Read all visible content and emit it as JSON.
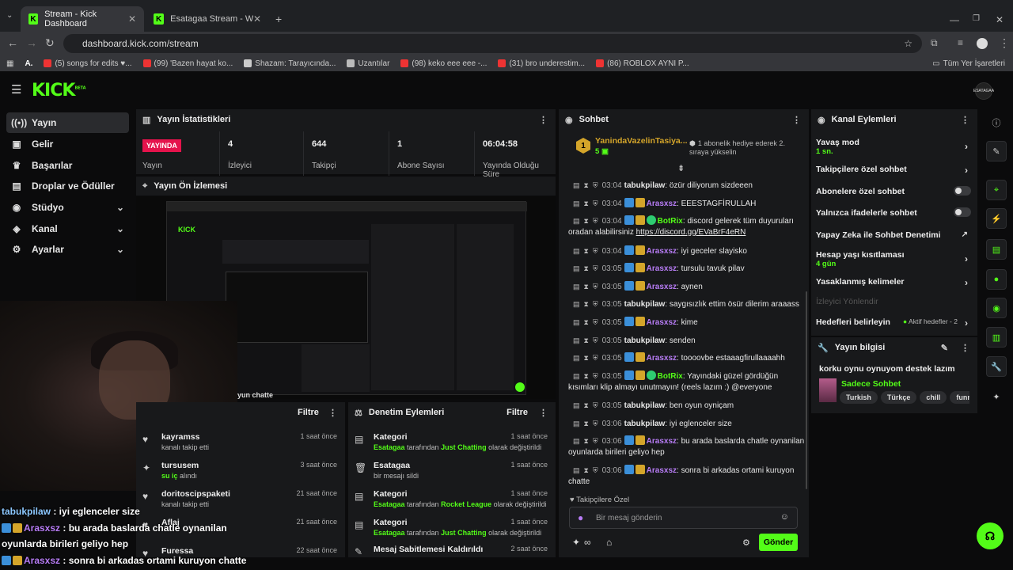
{
  "browser": {
    "tabs": [
      {
        "title": "Stream - Kick Dashboard",
        "active": true
      },
      {
        "title": "Esatagaa Stream - Watch Live o",
        "active": false
      }
    ],
    "url": "dashboard.kick.com/stream",
    "bookmarks": [
      "(5) songs for edits ♥...",
      "(99) 'Bazen hayat ko...",
      "Shazam: Tarayıcında...",
      "Uzantılar",
      "(98) keko eee eee -...",
      "(31) bro underestim...",
      "(86) ROBLOX AYNI P..."
    ],
    "all_bookmarks": "Tüm Yer İşaretleri",
    "avatar_label": "ESATAGAA"
  },
  "kick": {
    "logo": "KICK",
    "beta": "BETA"
  },
  "sidebar": {
    "items": [
      {
        "label": "Yayın",
        "icon": "broadcast-icon"
      },
      {
        "label": "Gelir",
        "icon": "wallet-icon"
      },
      {
        "label": "Başarılar",
        "icon": "trophy-icon"
      },
      {
        "label": "Droplar ve Ödüller",
        "icon": "gift-icon"
      },
      {
        "label": "Stüdyo",
        "icon": "studio-icon"
      },
      {
        "label": "Kanal",
        "icon": "channel-icon"
      },
      {
        "label": "Ayarlar",
        "icon": "gear-icon"
      }
    ]
  },
  "stats": {
    "title": "Yayın İstatistikleri",
    "live": "YAYINDA",
    "status_label": "Yayın",
    "viewers": "4",
    "viewers_label": "İzleyici",
    "followers": "644",
    "followers_label": "Takipçi",
    "subs": "1",
    "subs_label": "Abone Sayısı",
    "uptime": "06:04:58",
    "uptime_label": "Yayında Olduğu Süre"
  },
  "preview": {
    "title": "Yayın Ön İzlemesi",
    "caption": "yun chatte"
  },
  "activity": {
    "filter": "Filtre",
    "items": [
      {
        "name": "kayramss",
        "desc": "kanalı takip etti",
        "time": "1 saat önce"
      },
      {
        "name": "tursusem",
        "desc_pre": "",
        "desc_hl": "su iç",
        "desc_post": " alındı",
        "time": "3 saat önce"
      },
      {
        "name": "doritoscipspaketi",
        "desc": "kanalı takip etti",
        "time": "21 saat önce"
      },
      {
        "name": "Aflaj",
        "desc": "",
        "time": "21 saat önce"
      },
      {
        "name": "Furessa",
        "desc": "",
        "time": "22 saat önce"
      }
    ]
  },
  "moderation": {
    "title": "Denetim Eylemleri",
    "filter": "Filtre",
    "items": [
      {
        "title": "Kategori",
        "by": "Esatagaa",
        "mid": " tarafından ",
        "cat": "Just Chatting",
        "post": " olarak değiştirildi",
        "time": "1 saat önce"
      },
      {
        "title": "Esatagaa",
        "plain": "bir mesajı sildi",
        "time": "1 saat önce"
      },
      {
        "title": "Kategori",
        "by": "Esatagaa",
        "mid": " tarafından ",
        "cat": "Rocket League",
        "post": " olarak değiştirildi",
        "time": "1 saat önce"
      },
      {
        "title": "Kategori",
        "by": "Esatagaa",
        "mid": " tarafından ",
        "cat": "Just Chatting",
        "post": " olarak değiştirildi",
        "time": "1 saat önce"
      },
      {
        "title": "Mesaj Sabitlemesi Kaldırıldı",
        "plain": "",
        "time": "2 saat önce"
      }
    ]
  },
  "chat": {
    "title": "Sohbet",
    "gifter": "YanindaVazelinTasiya...",
    "gifter_count": "5",
    "gift_note": "1 abonelik hediye ederek 2. sıraya yükselin",
    "followers_only": "Takipçilere Özel",
    "placeholder": "Bir mesaj gönderin",
    "send": "Gönder",
    "messages": [
      {
        "time": "03:04",
        "user": "tabukpilaw",
        "color": "white",
        "badges": [],
        "text": "özür diliyorum sizdeeen"
      },
      {
        "time": "03:04",
        "user": "Arasxsz",
        "color": "purple",
        "badges": [
          "blue",
          "gold"
        ],
        "text": "EEESTAGFİRULLAH"
      },
      {
        "time": "03:04",
        "user": "BotRix",
        "color": "green",
        "badges": [
          "blue",
          "gold",
          "green"
        ],
        "text": "discord gelerek tüm duyuruları oradan alabilirsiniz ",
        "link": "https://discord.gg/EVaBrF4eRN"
      },
      {
        "time": "03:04",
        "user": "Arasxsz",
        "color": "purple",
        "badges": [
          "blue",
          "gold"
        ],
        "text": "iyi geceler slayisko"
      },
      {
        "time": "03:05",
        "user": "Arasxsz",
        "color": "purple",
        "badges": [
          "blue",
          "gold"
        ],
        "text": "tursulu tavuk pilav"
      },
      {
        "time": "03:05",
        "user": "Arasxsz",
        "color": "purple",
        "badges": [
          "blue",
          "gold"
        ],
        "text": "aynen"
      },
      {
        "time": "03:05",
        "user": "tabukpilaw",
        "color": "white",
        "badges": [],
        "text": "saygısızlık ettim ösür dilerim araaass"
      },
      {
        "time": "03:05",
        "user": "Arasxsz",
        "color": "purple",
        "badges": [
          "blue",
          "gold"
        ],
        "text": "kime"
      },
      {
        "time": "03:05",
        "user": "tabukpilaw",
        "color": "white",
        "badges": [],
        "text": "senden"
      },
      {
        "time": "03:05",
        "user": "Arasxsz",
        "color": "purple",
        "badges": [
          "blue",
          "gold"
        ],
        "text": "toooovbe estaaagfirullaaaahh"
      },
      {
        "time": "03:05",
        "user": "BotRix",
        "color": "green",
        "badges": [
          "blue",
          "gold",
          "green"
        ],
        "text": "Yayındaki güzel gördüğün kısımları klip almayı unutmayın! (reels lazım :) @everyone"
      },
      {
        "time": "03:05",
        "user": "tabukpilaw",
        "color": "white",
        "badges": [],
        "text": "ben oyun oyniçam"
      },
      {
        "time": "03:06",
        "user": "tabukpilaw",
        "color": "white",
        "badges": [],
        "text": "iyi eglenceler size"
      },
      {
        "time": "03:06",
        "user": "Arasxsz",
        "color": "purple",
        "badges": [
          "blue",
          "gold"
        ],
        "text": "bu arada baslarda chatle oynanilan oyunlarda birileri geliyo hep"
      },
      {
        "time": "03:06",
        "user": "Arasxsz",
        "color": "purple",
        "badges": [
          "blue",
          "gold"
        ],
        "text": "sonra bi arkadas ortami kuruyon chatte"
      }
    ]
  },
  "channel_actions": {
    "title": "Kanal Eylemleri",
    "slow_mode": "Yavaş mod",
    "slow_mode_value": "1 sn.",
    "followers_chat": "Takipçilere özel sohbet",
    "subs_chat": "Abonelere özel sohbet",
    "emote_chat": "Yalnızca ifadelerle sohbet",
    "ai_mod": "Yapay Zeka ile Sohbet Denetimi",
    "age_limit": "Hesap yaşı kısıtlaması",
    "age_limit_value": "4 gün",
    "banned_words": "Yasaklanmış kelimeler",
    "redirect": "İzleyici Yönlendir",
    "goals": "Hedefleri belirleyin",
    "goals_value": "Aktif hedefler - 2"
  },
  "stream_info": {
    "title": "Yayın bilgisi",
    "stream_title": "korku oynu oynuyom destek lazım",
    "category": "Sadece Sohbet",
    "tags": [
      "Turkish",
      "Türkçe",
      "chill",
      "funny"
    ]
  },
  "overlay": [
    {
      "user": "tabukpilaw",
      "text": " : iyi eglenceler size",
      "color": "#8cc8ff"
    },
    {
      "user": "Arasxsz",
      "text": " : bu arada baslarda chatle oynanilan",
      "color": "#b77cf5"
    },
    {
      "user": "",
      "text": "oyunlarda birileri geliyo hep",
      "color": "#fff"
    },
    {
      "user": "Arasxsz",
      "text": " : sonra bi arkadas ortami kuruyon chatte",
      "color": "#b77cf5"
    }
  ]
}
